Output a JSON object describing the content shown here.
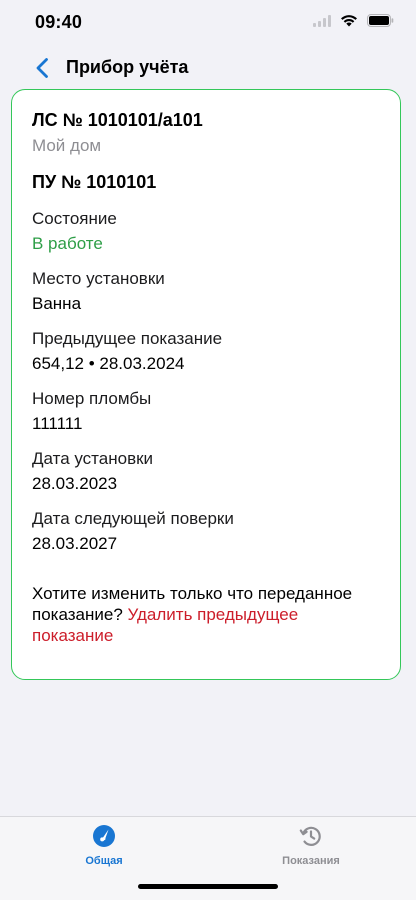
{
  "status_bar": {
    "time": "09:40"
  },
  "nav": {
    "title": "Прибор учёта"
  },
  "card": {
    "account_number": "ЛС № 1010101/а101",
    "account_home": "Мой дом",
    "meter_number": "ПУ № 1010101",
    "fields": [
      {
        "label": "Состояние",
        "value": "В работе"
      },
      {
        "label": "Место установки",
        "value": "Ванна"
      },
      {
        "label": "Предыдущее показание",
        "value": "654,12 • 28.03.2024"
      },
      {
        "label": "Номер пломбы",
        "value": "111111"
      },
      {
        "label": "Дата установки",
        "value": "28.03.2023"
      },
      {
        "label": "Дата следующей поверки",
        "value": "28.03.2027"
      }
    ],
    "hint_text": "Хотите изменить только что переданное показание? ",
    "hint_link": "Удалить предыдущее показание"
  },
  "tabs": [
    {
      "label": "Общая",
      "icon": "gauge-icon",
      "active": true
    },
    {
      "label": "Показания",
      "icon": "history-icon",
      "active": false
    }
  ],
  "colors": {
    "accent": "#1976d2",
    "border_green": "#34c759",
    "status_green": "#2e9e47",
    "link_red": "#cc1d2a",
    "muted": "#8e8e93",
    "background": "#f2f2f7"
  }
}
